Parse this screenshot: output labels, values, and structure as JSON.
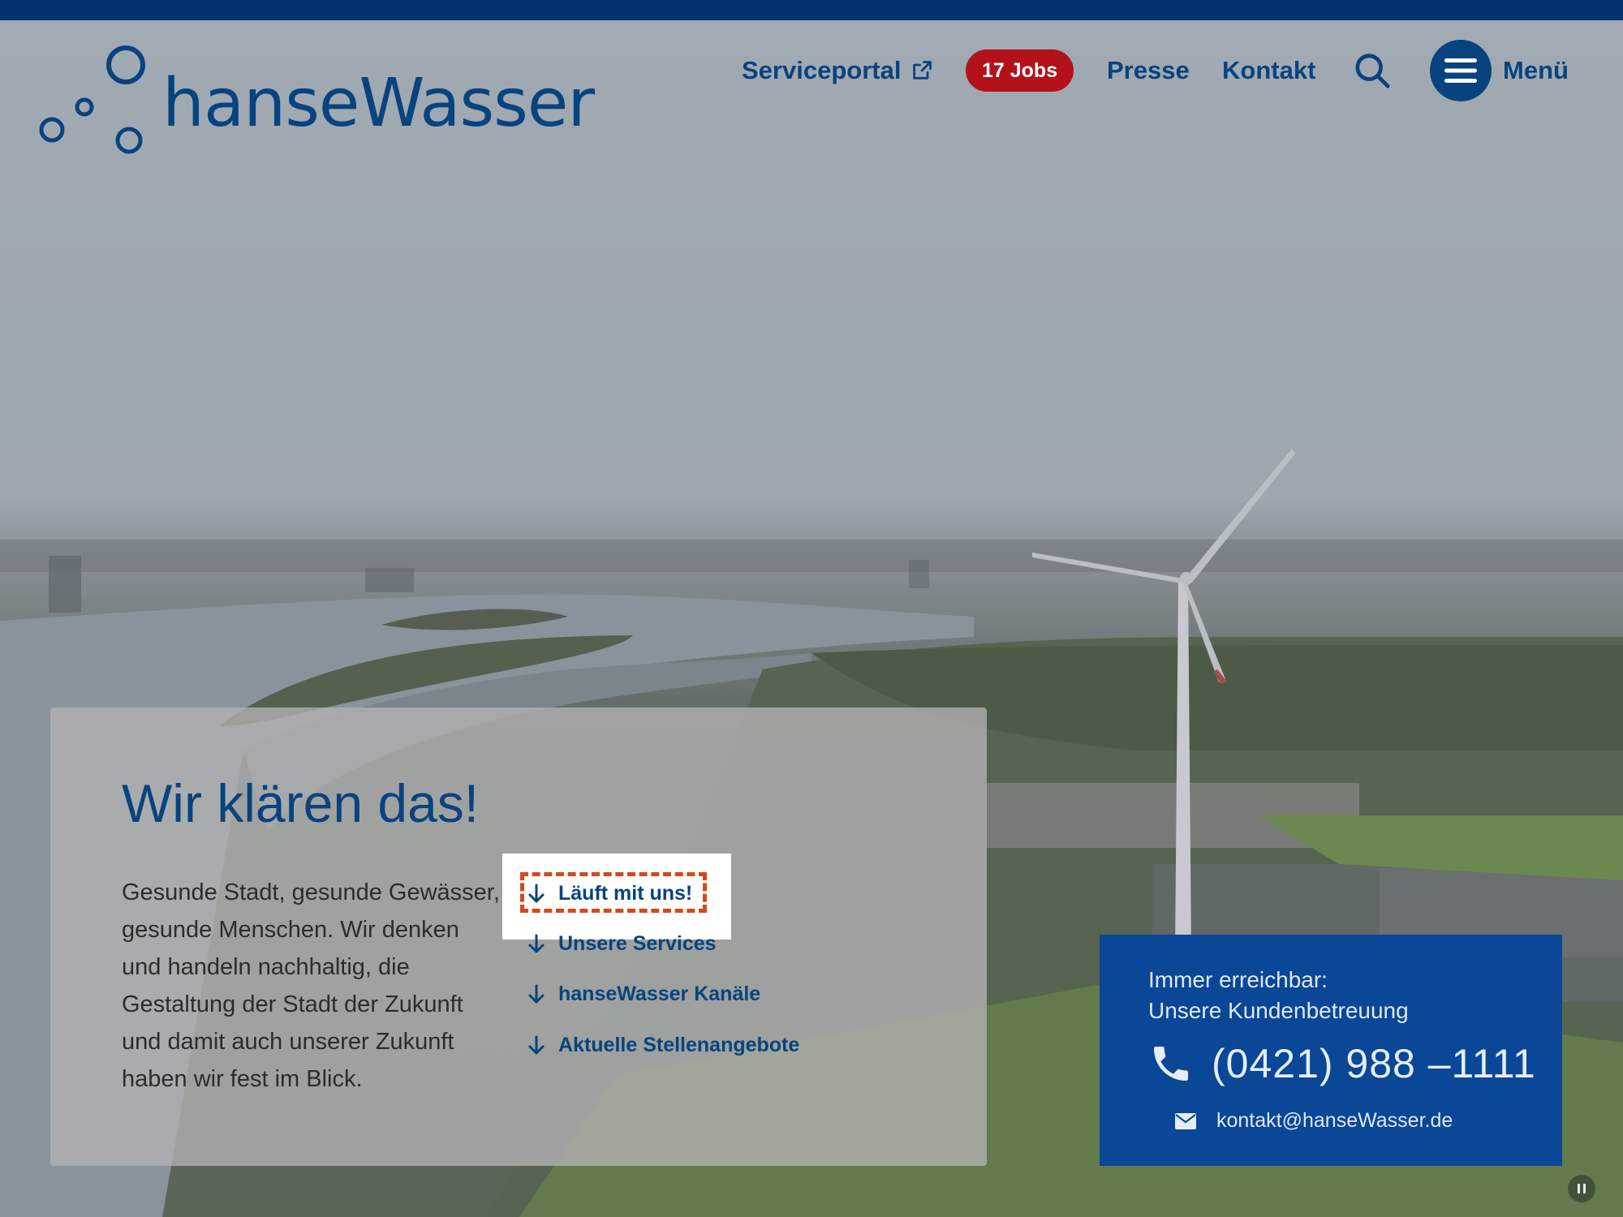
{
  "header": {
    "logo_text": "hanseWasser",
    "nav": {
      "serviceportal": "Serviceportal",
      "jobs_badge": "17 Jobs",
      "presse": "Presse",
      "kontakt": "Kontakt",
      "menu": "Menü"
    }
  },
  "hero": {
    "title": "Wir klären das!",
    "text": "Gesunde Stadt, gesunde Gewässer, gesunde Menschen. Wir denken und handeln nachhaltig, die Gestaltung der Stadt der Zukunft und damit auch unserer Zukunft haben wir fest im Blick.",
    "links": [
      {
        "label": "Läuft mit uns!"
      },
      {
        "label": "Unsere Services"
      },
      {
        "label": "hanseWasser Kanäle"
      },
      {
        "label": "Aktuelle Stellenangebote"
      }
    ]
  },
  "contact": {
    "label_line1": "Immer erreichbar:",
    "label_line2": "Unsere Kundenbetreuung",
    "phone": "(0421) 988 –1111",
    "email": "kontakt@hanseWasser.de"
  },
  "icons": {
    "external_link": "external-link-icon",
    "search": "search-icon",
    "menu": "hamburger-menu-icon",
    "arrow_down": "arrow-down-icon",
    "phone": "phone-icon",
    "mail": "mail-icon",
    "pause": "pause-icon"
  },
  "colors": {
    "brand_blue": "#08437f",
    "top_bar": "#03336f",
    "jobs_red": "#b3121b",
    "contact_bg": "#0a4796",
    "focus_outline": "#d34a1a"
  }
}
